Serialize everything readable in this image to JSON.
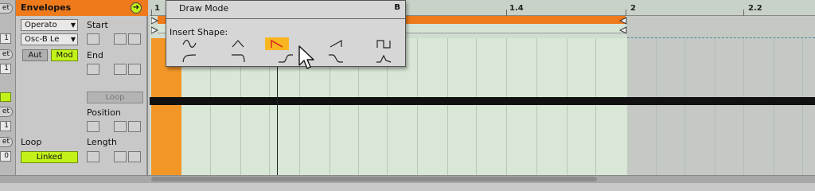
{
  "left_strip": {
    "buttons": [
      "et",
      "et",
      "et",
      "et"
    ],
    "numbers": [
      "1",
      "1",
      "1",
      "0"
    ]
  },
  "envelope_panel": {
    "title": "Envelopes",
    "device_dropdown": "Operato",
    "param_dropdown": "Osc-B Le",
    "aut_label": "Aut",
    "mod_label": "Mod",
    "start_label": "Start",
    "end_label": "End",
    "loop_button": "Loop",
    "position_label": "Position",
    "loop_label": "Loop",
    "length_label": "Length",
    "linked_label": "Linked"
  },
  "ruler": {
    "labels": [
      "1",
      "1.4",
      "2",
      "2.2"
    ]
  },
  "popup": {
    "draw_mode": "Draw Mode",
    "draw_mode_key": "B",
    "insert_shape_label": "Insert Shape:",
    "shapes_row1": [
      "sine-shape-icon",
      "triangle-shape-icon",
      "saw-down-shape-icon",
      "saw-up-shape-icon",
      "square-shape-icon"
    ],
    "shapes_row2": [
      "ads-ramp-up-icon",
      "adsr-ramp-down-icon",
      "s-curve-up-icon",
      "s-curve-down-icon",
      "adsr-shape-icon"
    ],
    "selected_shape": "saw-down-shape-icon"
  },
  "colors": {
    "accent_orange": "#ee7a1b",
    "lime": "#c2f21a",
    "selected_shape_bg": "#f8b620",
    "shape_red": "#d81e1e"
  }
}
